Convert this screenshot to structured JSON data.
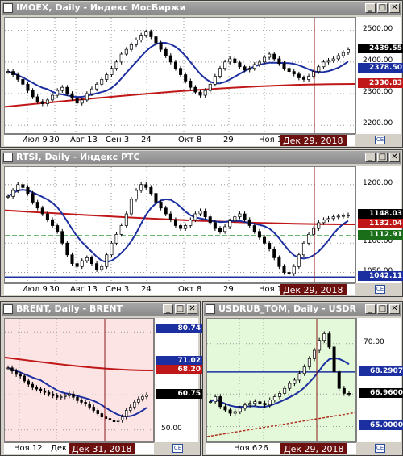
{
  "windows": [
    {
      "id": "imoex",
      "title": "IMOEX, Daily - Индекс МосБиржи",
      "y_ticks": [
        "2500.00",
        "2400.00",
        "2300.00",
        "2200.00"
      ],
      "badges": [
        {
          "text": "2439.55",
          "bg": "#000000",
          "fg": "#ffffff"
        },
        {
          "text": "2378.50",
          "bg": "#1c2fa0",
          "fg": "#ffffff"
        },
        {
          "text": "2330.83",
          "bg": "#c01818",
          "fg": "#ffffff"
        }
      ],
      "x_labels": [
        "Июл 9",
        "30",
        "Авг 13",
        "Сен 3",
        "24",
        "Окт 8",
        "29",
        "Ноя 12"
      ],
      "cursor_date": "Дек 29, 2018",
      "chart_data": {
        "type": "line",
        "ylim": [
          2170,
          2540
        ],
        "close": [
          2370,
          2360,
          2345,
          2330,
          2310,
          2290,
          2275,
          2268,
          2280,
          2295,
          2310,
          2320,
          2300,
          2285,
          2270,
          2280,
          2300,
          2315,
          2330,
          2345,
          2360,
          2380,
          2400,
          2425,
          2440,
          2455,
          2470,
          2485,
          2495,
          2480,
          2460,
          2440,
          2420,
          2400,
          2380,
          2360,
          2340,
          2320,
          2305,
          2295,
          2310,
          2330,
          2355,
          2380,
          2400,
          2410,
          2398,
          2385,
          2375,
          2380,
          2392,
          2400,
          2415,
          2425,
          2410,
          2395,
          2380,
          2370,
          2362,
          2350,
          2345,
          2355,
          2370,
          2385,
          2400,
          2405,
          2410,
          2420,
          2430,
          2439.55
        ],
        "sma_blue": 2378.5,
        "sma_red": 2330.83
      }
    },
    {
      "id": "rtsi",
      "title": "RTSI, Daily - Индекс РТС",
      "y_ticks": [
        "1200.00",
        "1100.00",
        "1050.00"
      ],
      "badges": [
        {
          "text": "1148.03",
          "bg": "#000000",
          "fg": "#ffffff"
        },
        {
          "text": "1132.04",
          "bg": "#c01818",
          "fg": "#ffffff"
        },
        {
          "text": "1112.91",
          "bg": "#1a6e1a",
          "fg": "#ffffff"
        },
        {
          "text": "1042.11",
          "bg": "#1c2fa0",
          "fg": "#ffffff"
        }
      ],
      "x_labels": [
        "Июл 9",
        "30",
        "Авг 13",
        "Сен 3",
        "24",
        "Окт 8",
        "29",
        "Ноя 12"
      ],
      "cursor_date": "Дек 29, 2018",
      "chart_data": {
        "type": "line",
        "ylim": [
          1030,
          1230
        ],
        "close": [
          1180,
          1190,
          1200,
          1195,
          1185,
          1170,
          1160,
          1150,
          1140,
          1130,
          1120,
          1100,
          1080,
          1065,
          1060,
          1070,
          1075,
          1065,
          1055,
          1060,
          1080,
          1100,
          1115,
          1130,
          1150,
          1175,
          1190,
          1200,
          1195,
          1185,
          1170,
          1160,
          1150,
          1140,
          1130,
          1125,
          1130,
          1140,
          1150,
          1155,
          1145,
          1135,
          1125,
          1120,
          1128,
          1138,
          1145,
          1150,
          1140,
          1130,
          1120,
          1110,
          1100,
          1090,
          1075,
          1060,
          1050,
          1048,
          1060,
          1080,
          1100,
          1115,
          1125,
          1135,
          1140,
          1142,
          1145,
          1146,
          1147,
          1148.03
        ],
        "sma_red": 1132.04,
        "level_green": 1112.91,
        "level_blue": 1042.11
      }
    },
    {
      "id": "brent",
      "title": "BRENT, Daily - BRENT",
      "y_ticks": [
        "80.00",
        "60.75",
        "50.00"
      ],
      "badges": [
        {
          "text": "80.74",
          "bg": "#1c2fa0",
          "fg": "#ffffff"
        },
        {
          "text": "71.02",
          "bg": "#1c2fa0",
          "fg": "#ffffff"
        },
        {
          "text": "68.20",
          "bg": "#c01818",
          "fg": "#ffffff"
        },
        {
          "text": "60.75",
          "bg": "#000000",
          "fg": "#ffffff"
        }
      ],
      "x_labels": [
        "Ноя 12",
        "Дек"
      ],
      "cursor_date": "Дек 31, 2018",
      "chart_data": {
        "type": "line",
        "ylim": [
          46,
          84
        ],
        "close": [
          69,
          68,
          67,
          66.5,
          65,
          64,
          63,
          62.5,
          62,
          61.5,
          61,
          60.5,
          60,
          60.2,
          60.5,
          61,
          60,
          59,
          58.5,
          58,
          57,
          56,
          55,
          54,
          53.5,
          53,
          52.5,
          53,
          54,
          56,
          57,
          58.5,
          59.5,
          60.2,
          60.75
        ],
        "sma_blue": 71.02,
        "sma_red": 68.2
      }
    },
    {
      "id": "usdrub",
      "title": "USDRUB_TOM, Daily - USDR",
      "y_ticks": [
        "70.00",
        "68.2907",
        "66.9600",
        "65.0000"
      ],
      "badges": [
        {
          "text": "68.2907",
          "bg": "#1c2fa0",
          "fg": "#ffffff"
        },
        {
          "text": "66.9600",
          "bg": "#000000",
          "fg": "#ffffff"
        },
        {
          "text": "65.0000",
          "bg": "#1c2fa0",
          "fg": "#ffffff"
        }
      ],
      "x_labels": [
        "Ноя 6",
        "26"
      ],
      "cursor_date": "Дек 29, 2018",
      "chart_data": {
        "type": "line",
        "ylim": [
          64.0,
          71.5
        ],
        "close": [
          66.5,
          66.8,
          66.2,
          66.0,
          65.8,
          65.9,
          66.1,
          66.3,
          66.4,
          66.5,
          66.4,
          66.3,
          66.6,
          66.8,
          67.0,
          67.3,
          67.6,
          67.8,
          68.2,
          68.6,
          69.1,
          69.6,
          70.2,
          70.6,
          69.8,
          68.3,
          67.3,
          67.0,
          66.96
        ],
        "sma_blue": 66.96,
        "level_blue": 68.2907
      }
    }
  ],
  "ui": {
    "btn_min": "_",
    "btn_max": "□",
    "btn_close": "✕",
    "corner": "CE"
  }
}
